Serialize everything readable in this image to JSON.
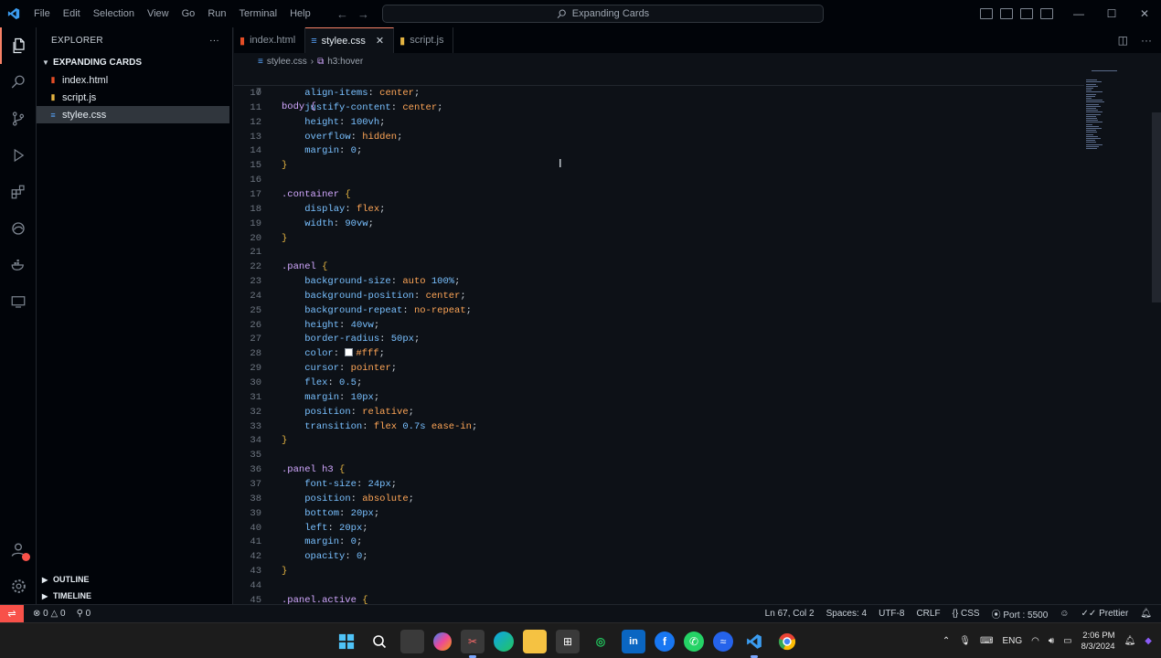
{
  "window": {
    "title": "Expanding Cards",
    "menu": [
      "File",
      "Edit",
      "Selection",
      "View",
      "Go",
      "Run",
      "Terminal",
      "Help"
    ]
  },
  "sidebar": {
    "title": "EXPLORER",
    "more": "···",
    "folder": "EXPANDING CARDS",
    "files": [
      {
        "name": "index.html",
        "icon": "html-file-icon",
        "color": "#e44d26"
      },
      {
        "name": "script.js",
        "icon": "js-file-icon",
        "color": "#e3b341"
      },
      {
        "name": "stylee.css",
        "icon": "css-file-icon",
        "color": "#58a6ff"
      }
    ],
    "outline": "OUTLINE",
    "timeline": "TIMELINE"
  },
  "tabs": [
    {
      "label": "index.html",
      "icon": "html-file-icon",
      "color": "#e44d26"
    },
    {
      "label": "stylee.css",
      "icon": "css-file-icon",
      "color": "#58a6ff",
      "active": true
    },
    {
      "label": "script.js",
      "icon": "js-file-icon",
      "color": "#e3b341"
    }
  ],
  "breadcrumb": {
    "file": "stylee.css",
    "symbol": "h3:hover"
  },
  "editor": {
    "sticky": {
      "ln": "7",
      "text": "body {"
    },
    "lines": [
      {
        "ln": "10",
        "text": "    align-items: center;"
      },
      {
        "ln": "11",
        "text": "    justify-content: center;"
      },
      {
        "ln": "12",
        "text": "    height: 100vh;"
      },
      {
        "ln": "13",
        "text": "    overflow: hidden;"
      },
      {
        "ln": "14",
        "text": "    margin: 0;"
      },
      {
        "ln": "15",
        "text": "}"
      },
      {
        "ln": "16",
        "text": ""
      },
      {
        "ln": "17",
        "text": ".container {"
      },
      {
        "ln": "18",
        "text": "    display: flex;"
      },
      {
        "ln": "19",
        "text": "    width: 90vw;"
      },
      {
        "ln": "20",
        "text": "}"
      },
      {
        "ln": "21",
        "text": ""
      },
      {
        "ln": "22",
        "text": ".panel {"
      },
      {
        "ln": "23",
        "text": "    background-size: auto 100%;"
      },
      {
        "ln": "24",
        "text": "    background-position: center;"
      },
      {
        "ln": "25",
        "text": "    background-repeat: no-repeat;"
      },
      {
        "ln": "26",
        "text": "    height: 40vw;"
      },
      {
        "ln": "27",
        "text": "    border-radius: 50px;"
      },
      {
        "ln": "28",
        "text": "    color: #fff;"
      },
      {
        "ln": "29",
        "text": "    cursor: pointer;"
      },
      {
        "ln": "30",
        "text": "    flex: 0.5;"
      },
      {
        "ln": "31",
        "text": "    margin: 10px;"
      },
      {
        "ln": "32",
        "text": "    position: relative;"
      },
      {
        "ln": "33",
        "text": "    transition: flex 0.7s ease-in;"
      },
      {
        "ln": "34",
        "text": "}"
      },
      {
        "ln": "35",
        "text": ""
      },
      {
        "ln": "36",
        "text": ".panel h3 {"
      },
      {
        "ln": "37",
        "text": "    font-size: 24px;"
      },
      {
        "ln": "38",
        "text": "    position: absolute;"
      },
      {
        "ln": "39",
        "text": "    bottom: 20px;"
      },
      {
        "ln": "40",
        "text": "    left: 20px;"
      },
      {
        "ln": "41",
        "text": "    margin: 0;"
      },
      {
        "ln": "42",
        "text": "    opacity: 0;"
      },
      {
        "ln": "43",
        "text": "}"
      },
      {
        "ln": "44",
        "text": ""
      },
      {
        "ln": "45",
        "text": ".panel.active {"
      }
    ]
  },
  "statusbar": {
    "errors": "0",
    "warnings": "0",
    "ports": "0",
    "position": "Ln 67, Col 2",
    "spaces": "Spaces: 4",
    "encoding": "UTF-8",
    "eol": "CRLF",
    "language": "CSS",
    "port": "Port : 5500",
    "prettier": "Prettier"
  },
  "taskbar": {
    "lang": "ENG",
    "time": "2:06 PM",
    "date": "8/3/2024"
  },
  "colors": {
    "accent": "#f78166",
    "error": "#f85149"
  }
}
